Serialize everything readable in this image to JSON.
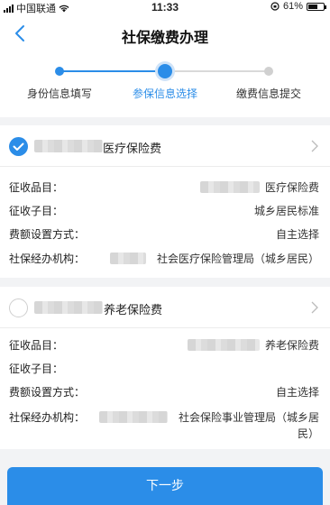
{
  "status": {
    "carrier": "中国联通",
    "time": "11:33",
    "battery": "61%",
    "battery_level": 0.61
  },
  "header": {
    "title": "社保缴费办理"
  },
  "steps": [
    {
      "label": "身份信息填写",
      "state": "done"
    },
    {
      "label": "参保信息选择",
      "state": "active"
    },
    {
      "label": "缴费信息提交",
      "state": "pending"
    }
  ],
  "cards": [
    {
      "title": "医疗保险费",
      "selected": true,
      "rows": [
        {
          "label": "征收品目：",
          "value": "医疗保险费"
        },
        {
          "label": "征收子目：",
          "value": "城乡居民标准"
        },
        {
          "label": "费额设置方式：",
          "value": "自主选择"
        },
        {
          "label": "社保经办机构：",
          "value": "社会医疗保险管理局（城乡居民）"
        }
      ]
    },
    {
      "title": "养老保险费",
      "selected": false,
      "rows": [
        {
          "label": "征收品目：",
          "value": "养老保险费"
        },
        {
          "label": "征收子目：",
          "value": ""
        },
        {
          "label": "费额设置方式：",
          "value": "自主选择"
        },
        {
          "label": "社保经办机构：",
          "value": "社会保险事业管理局（城乡居",
          "value2": "民）"
        }
      ]
    }
  ],
  "next_button": {
    "label": "下一步"
  },
  "colors": {
    "accent": "#2b8de8",
    "background": "#f2f3f5"
  }
}
